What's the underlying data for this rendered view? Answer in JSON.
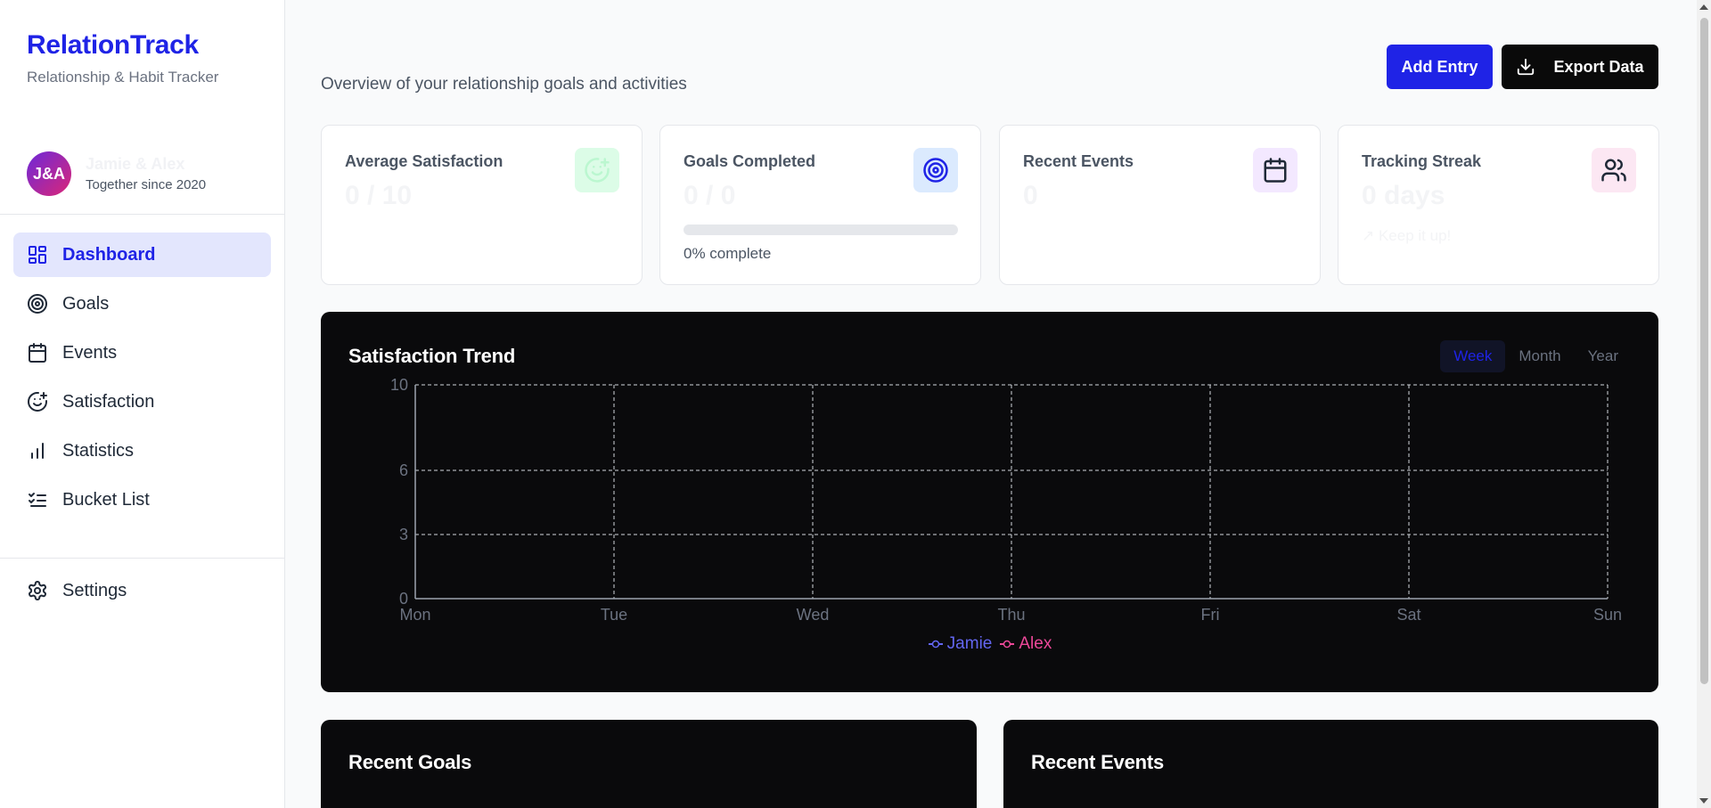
{
  "app": {
    "name": "RelationTrack",
    "tagline": "Relationship & Habit Tracker"
  },
  "profile": {
    "initials": "J&A",
    "names": "Jamie & Alex",
    "since": "Together since 2020"
  },
  "sidebar": {
    "items": [
      {
        "label": "Dashboard",
        "icon": "dashboard-icon",
        "active": true
      },
      {
        "label": "Goals",
        "icon": "target-icon"
      },
      {
        "label": "Events",
        "icon": "calendar-icon"
      },
      {
        "label": "Satisfaction",
        "icon": "smile-plus-icon"
      },
      {
        "label": "Statistics",
        "icon": "bar-chart-icon"
      },
      {
        "label": "Bucket List",
        "icon": "checklist-icon"
      }
    ],
    "settings_label": "Settings"
  },
  "header": {
    "subtitle": "Overview of your relationship goals and activities",
    "add_label": "Add Entry",
    "export_label": "Export Data"
  },
  "cards": {
    "satisfaction": {
      "title": "Average Satisfaction",
      "value": "0 / 10",
      "icon": "smile-plus-icon",
      "icon_bg": "#dcfce7",
      "icon_color": "#bbf7d0"
    },
    "goals": {
      "title": "Goals Completed",
      "value": "0 / 0",
      "progress": 0,
      "note": "0% complete",
      "icon": "target-icon",
      "icon_bg": "#dbeafe",
      "icon_color": "#1f23e6"
    },
    "events": {
      "title": "Recent Events",
      "value": "0",
      "icon": "calendar-icon",
      "icon_bg": "#f3e8ff",
      "icon_color": "#1f2937"
    },
    "streak": {
      "title": "Tracking Streak",
      "value": "0 days",
      "note": "Keep it up!",
      "icon": "users-icon",
      "icon_bg": "#fce7f3",
      "icon_color": "#1f2937"
    }
  },
  "trend": {
    "title": "Satisfaction Trend",
    "ranges": [
      "Week",
      "Month",
      "Year"
    ],
    "active_range": "Week"
  },
  "chart_data": {
    "type": "line",
    "x": [
      "Mon",
      "Tue",
      "Wed",
      "Thu",
      "Fri",
      "Sat",
      "Sun"
    ],
    "yticks": [
      0,
      3,
      6,
      10
    ],
    "ylim": [
      0,
      10
    ],
    "grid": true,
    "legend": "bottom-center",
    "series": [
      {
        "name": "Jamie",
        "color": "#6366f1",
        "values": []
      },
      {
        "name": "Alex",
        "color": "#ec4899",
        "values": []
      }
    ]
  },
  "recent_goals": {
    "title": "Recent Goals"
  },
  "recent_events": {
    "title": "Recent Events"
  },
  "colors": {
    "accent": "#1f23e6",
    "dark": "#0a0a0c"
  }
}
